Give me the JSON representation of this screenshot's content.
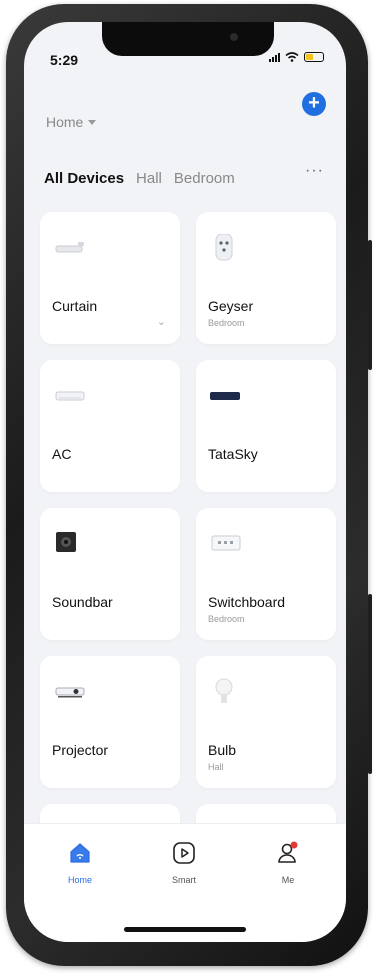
{
  "status": {
    "time": "5:29"
  },
  "header": {
    "home_label": "Home"
  },
  "tabs": [
    {
      "label": "All Devices",
      "active": true
    },
    {
      "label": "Hall",
      "active": false
    },
    {
      "label": "Bedroom",
      "active": false
    }
  ],
  "more_glyph": "···",
  "devices": [
    {
      "name": "Curtain",
      "room": "",
      "icon": "curtain-icon",
      "has_chevron": true
    },
    {
      "name": "Geyser",
      "room": "Bedroom",
      "icon": "plug-icon"
    },
    {
      "name": "AC",
      "room": "",
      "icon": "ac-icon"
    },
    {
      "name": "TataSky",
      "room": "",
      "icon": "settop-box-icon"
    },
    {
      "name": "Soundbar",
      "room": "",
      "icon": "speaker-icon"
    },
    {
      "name": "Switchboard",
      "room": "Bedroom",
      "icon": "switchboard-icon"
    },
    {
      "name": "Projector",
      "room": "",
      "icon": "projector-icon"
    },
    {
      "name": "Bulb",
      "room": "Hall",
      "icon": "bulb-icon"
    },
    {
      "name": "",
      "room": "",
      "icon": "smart-ring-icon"
    },
    {
      "name": "",
      "room": "",
      "icon": "switch-icon"
    }
  ],
  "tabbar": [
    {
      "label": "Home",
      "icon": "home-icon",
      "active": true
    },
    {
      "label": "Smart",
      "icon": "smart-play-icon",
      "active": false
    },
    {
      "label": "Me",
      "icon": "profile-icon",
      "active": false,
      "badge": true
    }
  ],
  "colors": {
    "accent": "#1f6fe0",
    "background": "#f2f3f6",
    "card": "#ffffff",
    "badge": "#e53935"
  }
}
